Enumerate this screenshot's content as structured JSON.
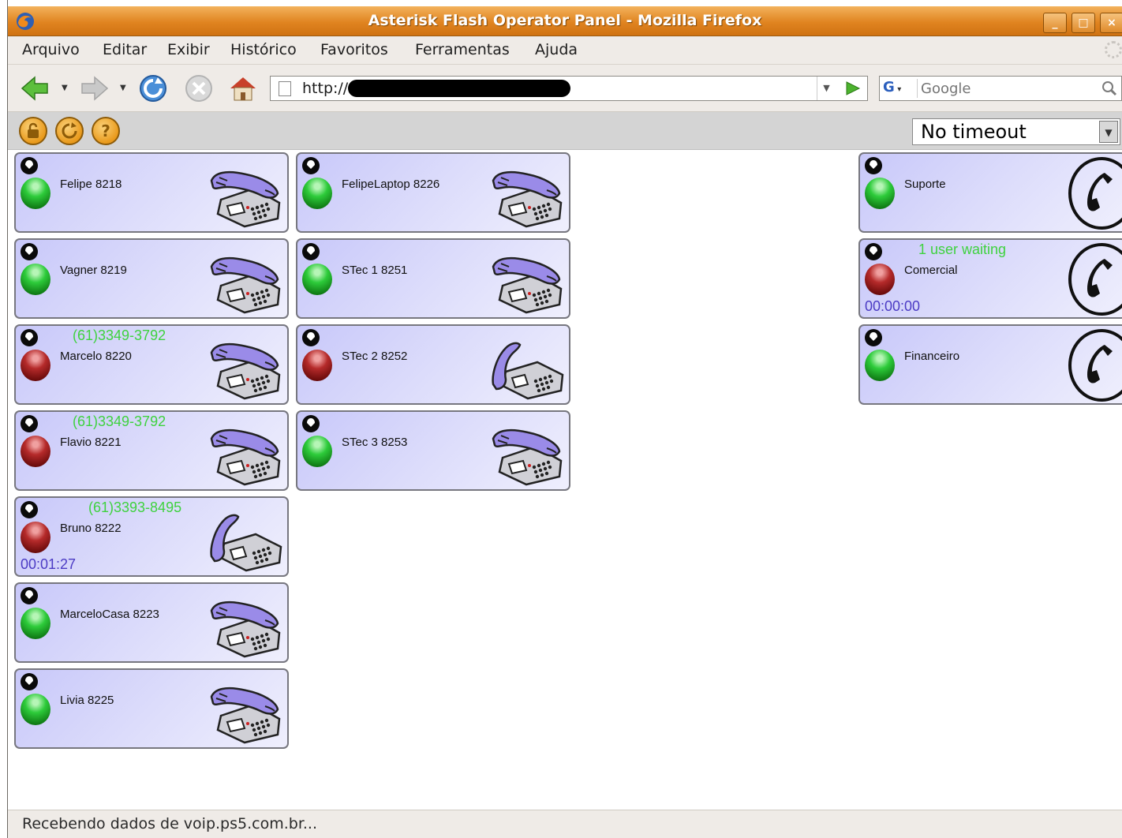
{
  "window": {
    "title": "Asterisk Flash Operator Panel - Mozilla Firefox"
  },
  "menu": [
    "Arquivo",
    "Editar",
    "Exibir",
    "Histórico",
    "Favoritos",
    "Ferramentas",
    "Ajuda"
  ],
  "nav": {
    "url": "http://",
    "search_placeholder": "Google",
    "search_engine_icon": "G"
  },
  "fop_toolbar": {
    "buttons": [
      "lock-icon",
      "reload-icon",
      "help-icon"
    ],
    "help_glyph": "?",
    "timeout_value": "No timeout"
  },
  "extensions": [
    {
      "name": "Felipe 8218",
      "status": "free",
      "callerid": "",
      "timer": ""
    },
    {
      "name": "Vagner 8219",
      "status": "free",
      "callerid": "",
      "timer": ""
    },
    {
      "name": "Marcelo 8220",
      "status": "busy",
      "callerid": "(61)3349-3792",
      "timer": ""
    },
    {
      "name": "Flavio 8221",
      "status": "busy",
      "callerid": "(61)3349-3792",
      "timer": ""
    },
    {
      "name": "Bruno 8222",
      "status": "busy",
      "callerid": "(61)3393-8495",
      "timer": "00:01:27"
    },
    {
      "name": "MarceloCasa 8223",
      "status": "free",
      "callerid": "",
      "timer": ""
    },
    {
      "name": "Livia 8225",
      "status": "free",
      "callerid": "",
      "timer": ""
    },
    {
      "name": "FelipeLaptop 8226",
      "status": "free",
      "callerid": "",
      "timer": ""
    },
    {
      "name": "STec 1 8251",
      "status": "free",
      "callerid": "",
      "timer": ""
    },
    {
      "name": "STec 2 8252",
      "status": "busy",
      "callerid": "",
      "timer": ""
    },
    {
      "name": "STec 3 8253",
      "status": "free",
      "callerid": "",
      "timer": ""
    }
  ],
  "queues": [
    {
      "name": "Suporte",
      "status": "free",
      "info": "",
      "timer": ""
    },
    {
      "name": "Comercial",
      "status": "busy",
      "info": "1 user waiting",
      "timer": "00:00:00"
    },
    {
      "name": "Financeiro",
      "status": "free",
      "info": "",
      "timer": ""
    }
  ],
  "status_bar": "Recebendo dados de voip.ps5.com.br...",
  "colors": {
    "titlebar": "#e08420",
    "card_bg": "#c8c8f9",
    "callerid": "#3fd23f",
    "timer": "#4b3bc4"
  }
}
